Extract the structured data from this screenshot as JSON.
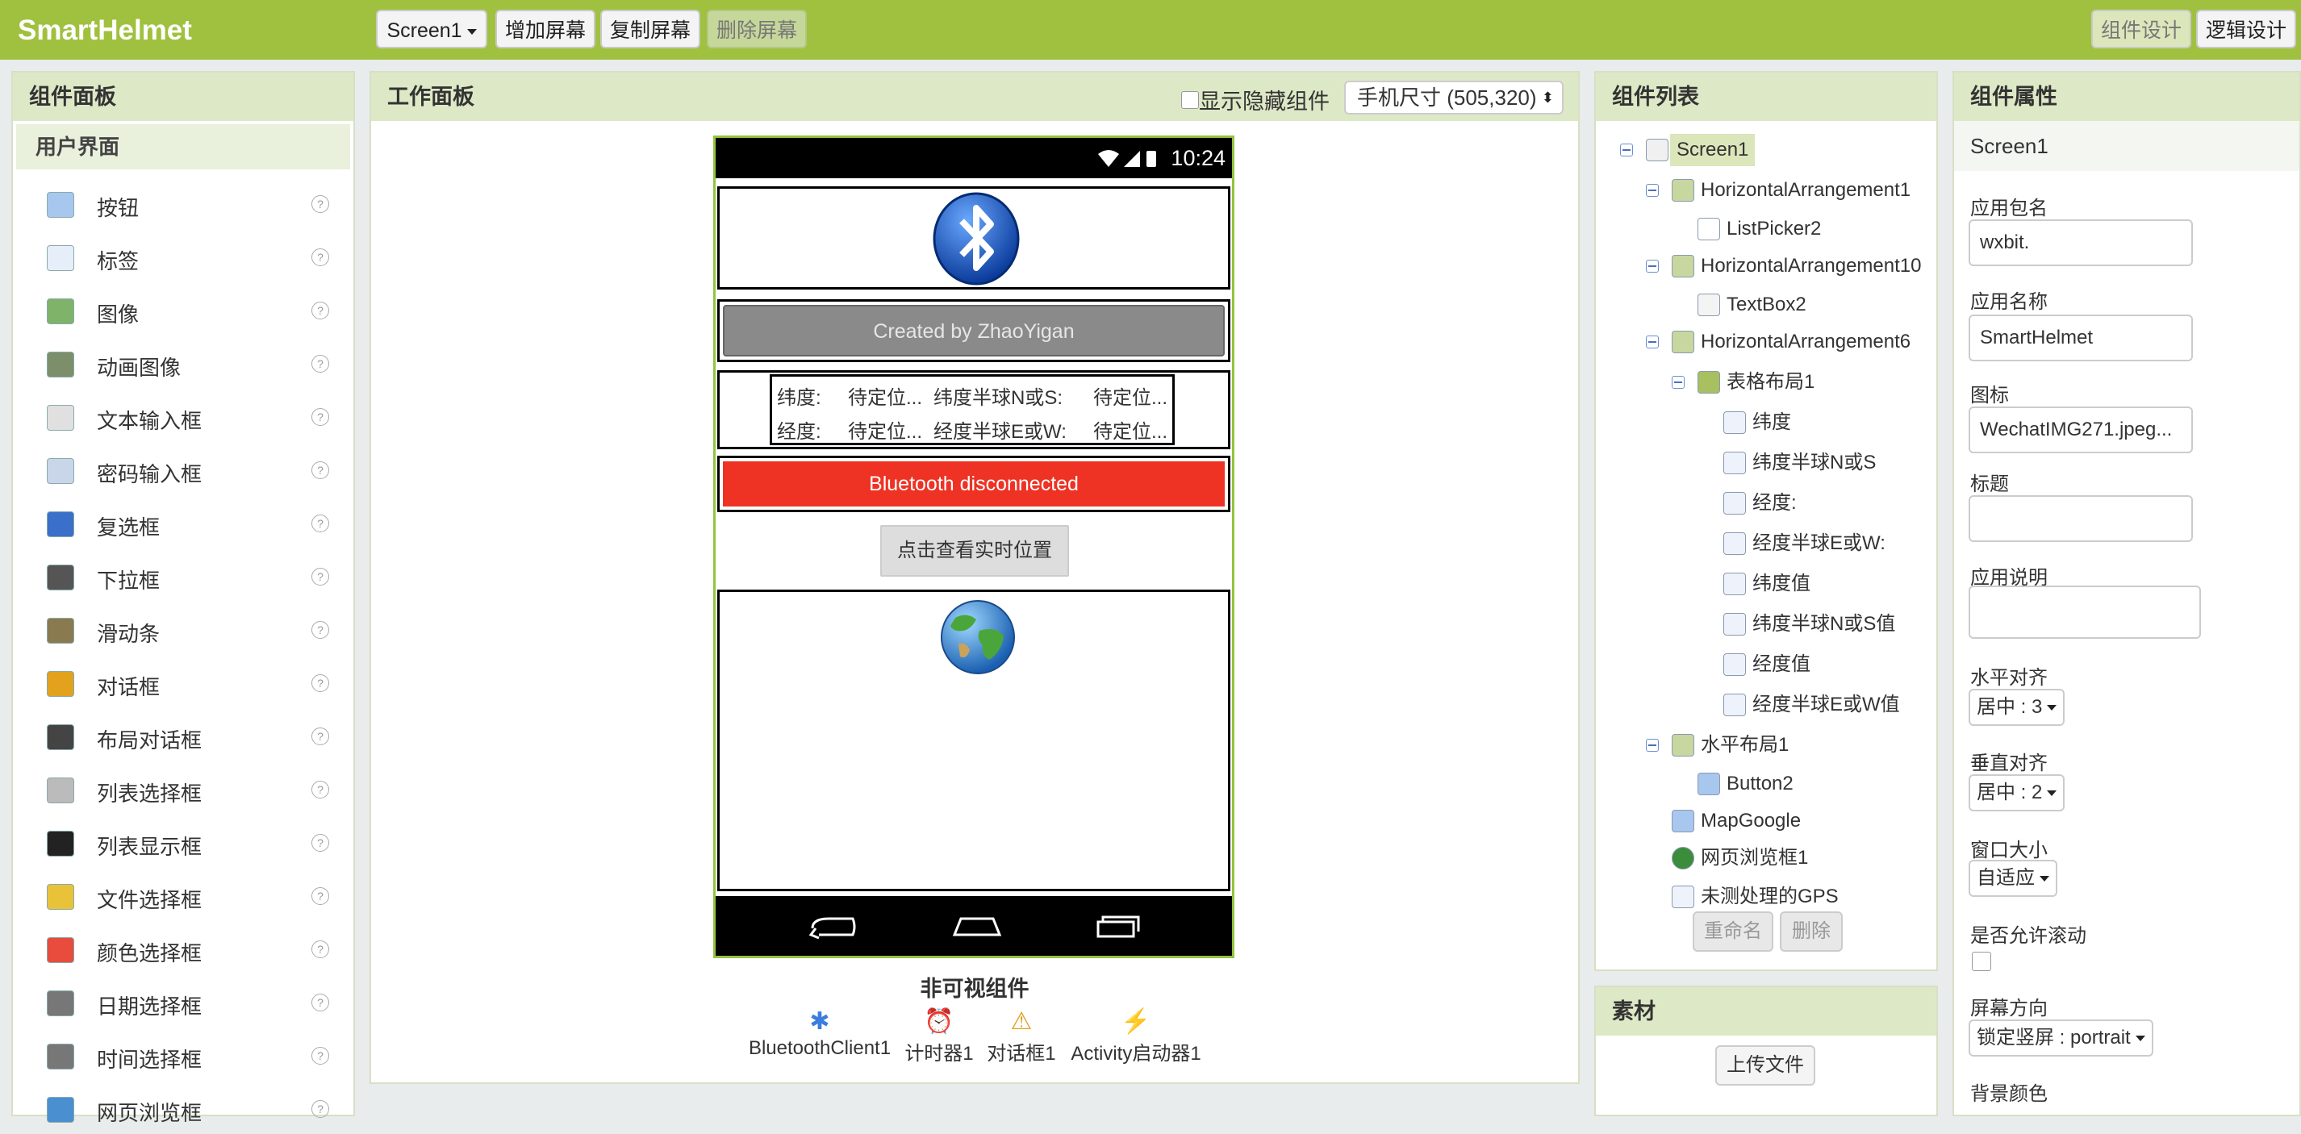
{
  "app": {
    "title": "SmartHelmet"
  },
  "toolbar": {
    "screen_select": "Screen1",
    "add_screen": "增加屏幕",
    "copy_screen": "复制屏幕",
    "delete_screen": "删除屏幕",
    "designer": "组件设计",
    "blocks": "逻辑设计"
  },
  "palette": {
    "title": "组件面板",
    "category": "用户界面",
    "help_symbol": "?",
    "items": [
      {
        "label": "按钮",
        "icon": "button-icon"
      },
      {
        "label": "标签",
        "icon": "label-icon"
      },
      {
        "label": "图像",
        "icon": "image-icon"
      },
      {
        "label": "动画图像",
        "icon": "animated-image-icon"
      },
      {
        "label": "文本输入框",
        "icon": "textbox-icon"
      },
      {
        "label": "密码输入框",
        "icon": "password-icon"
      },
      {
        "label": "复选框",
        "icon": "checkbox-icon"
      },
      {
        "label": "下拉框",
        "icon": "spinner-icon"
      },
      {
        "label": "滑动条",
        "icon": "slider-icon"
      },
      {
        "label": "对话框",
        "icon": "notifier-icon"
      },
      {
        "label": "布局对话框",
        "icon": "layout-dialog-icon"
      },
      {
        "label": "列表选择框",
        "icon": "listpicker-icon"
      },
      {
        "label": "列表显示框",
        "icon": "listview-icon"
      },
      {
        "label": "文件选择框",
        "icon": "filepicker-icon"
      },
      {
        "label": "颜色选择框",
        "icon": "colorpicker-icon"
      },
      {
        "label": "日期选择框",
        "icon": "datepicker-icon"
      },
      {
        "label": "时间选择框",
        "icon": "timepicker-icon"
      },
      {
        "label": "网页浏览框",
        "icon": "webviewer-icon"
      }
    ]
  },
  "viewer": {
    "title": "工作面板",
    "show_hidden": "显示隐藏组件",
    "phone_size": "手机尺寸 (505,320)",
    "status_time": "10:24",
    "created_by": "Created by ZhaoYigan",
    "table": {
      "row1": [
        "纬度:",
        "待定位...",
        "纬度半球N或S:",
        "待定位..."
      ],
      "row2": [
        "经度:",
        "待定位...",
        "经度半球E或W:",
        "待定位..."
      ]
    },
    "bt_status": "Bluetooth disconnected",
    "bt_status_color": "#ee3224",
    "locate_button": "点击查看实时位置",
    "nonvisible_title": "非可视组件",
    "nonvisible": [
      {
        "label": "BluetoothClient1",
        "icon": "bluetooth-icon"
      },
      {
        "label": "计时器1",
        "icon": "clock-icon"
      },
      {
        "label": "对话框1",
        "icon": "warning-icon"
      },
      {
        "label": "Activity启动器1",
        "icon": "lightning-icon"
      }
    ]
  },
  "components": {
    "title": "组件列表",
    "tree": [
      {
        "label": "Screen1",
        "selected": true
      },
      {
        "label": "HorizontalArrangement1"
      },
      {
        "label": "ListPicker2"
      },
      {
        "label": "HorizontalArrangement10"
      },
      {
        "label": "TextBox2"
      },
      {
        "label": "HorizontalArrangement6"
      },
      {
        "label": "表格布局1"
      },
      {
        "label": "纬度"
      },
      {
        "label": "纬度半球N或S"
      },
      {
        "label": "经度:"
      },
      {
        "label": "经度半球E或W:"
      },
      {
        "label": "纬度值"
      },
      {
        "label": "纬度半球N或S值"
      },
      {
        "label": "经度值"
      },
      {
        "label": "经度半球E或W值"
      },
      {
        "label": "水平布局1"
      },
      {
        "label": "Button2"
      },
      {
        "label": "MapGoogle"
      },
      {
        "label": "网页浏览框1"
      },
      {
        "label": "未测处理的GPS"
      }
    ],
    "rename": "重命名",
    "delete": "删除"
  },
  "media": {
    "title": "素材",
    "upload": "上传文件"
  },
  "properties": {
    "title": "组件属性",
    "component": "Screen1",
    "package_label": "应用包名",
    "package_value": "wxbit.",
    "appname_label": "应用名称",
    "appname_value": "SmartHelmet",
    "icon_label": "图标",
    "icon_value": "WechatIMG271.jpeg...",
    "title_label": "标题",
    "title_value": "",
    "about_label": "应用说明",
    "halign_label": "水平对齐",
    "halign_value": "居中 : 3",
    "valign_label": "垂直对齐",
    "valign_value": "居中 : 2",
    "size_label": "窗口大小",
    "size_value": "自适应",
    "scroll_label": "是否允许滚动",
    "orientation_label": "屏幕方向",
    "orientation_value": "锁定竖屏 : portrait",
    "bgcolor_label": "背景颜色"
  }
}
